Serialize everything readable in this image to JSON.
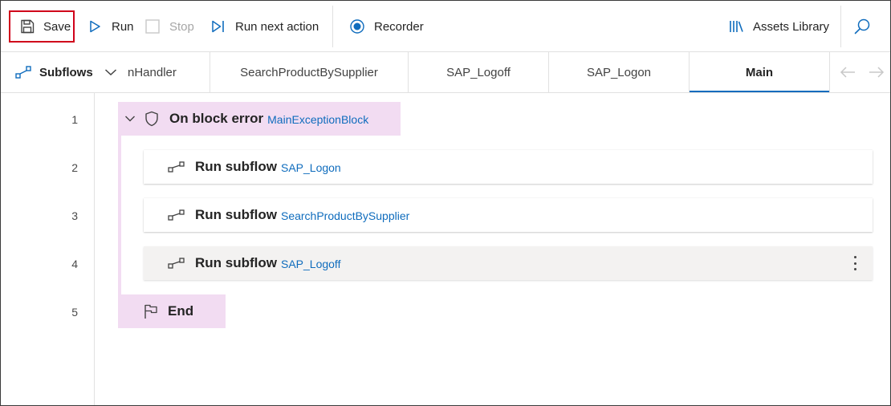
{
  "toolbar": {
    "save_label": "Save",
    "run_label": "Run",
    "stop_label": "Stop",
    "run_next_label": "Run next action",
    "recorder_label": "Recorder",
    "assets_label": "Assets Library",
    "search_icon": "search-icon",
    "highlight_color": "#d0021b"
  },
  "tabs": {
    "subflows_label": "Subflows",
    "items": [
      {
        "label": "nHandler"
      },
      {
        "label": "SearchProductBySupplier"
      },
      {
        "label": "SAP_Logoff"
      },
      {
        "label": "SAP_Logon"
      },
      {
        "label": "Main",
        "active": true
      }
    ],
    "accent": "#0f6cbd"
  },
  "editor": {
    "line_numbers": [
      "1",
      "2",
      "3",
      "4",
      "5"
    ],
    "block": {
      "title": "On block error",
      "name": "MainExceptionBlock",
      "end_label": "End",
      "color": "#f2dcf2"
    },
    "actions": [
      {
        "title": "Run subflow",
        "target": "SAP_Logon"
      },
      {
        "title": "Run subflow",
        "target": "SearchProductBySupplier"
      },
      {
        "title": "Run subflow",
        "target": "SAP_Logoff",
        "selected": true
      }
    ],
    "link_color": "#0f6cbd"
  }
}
